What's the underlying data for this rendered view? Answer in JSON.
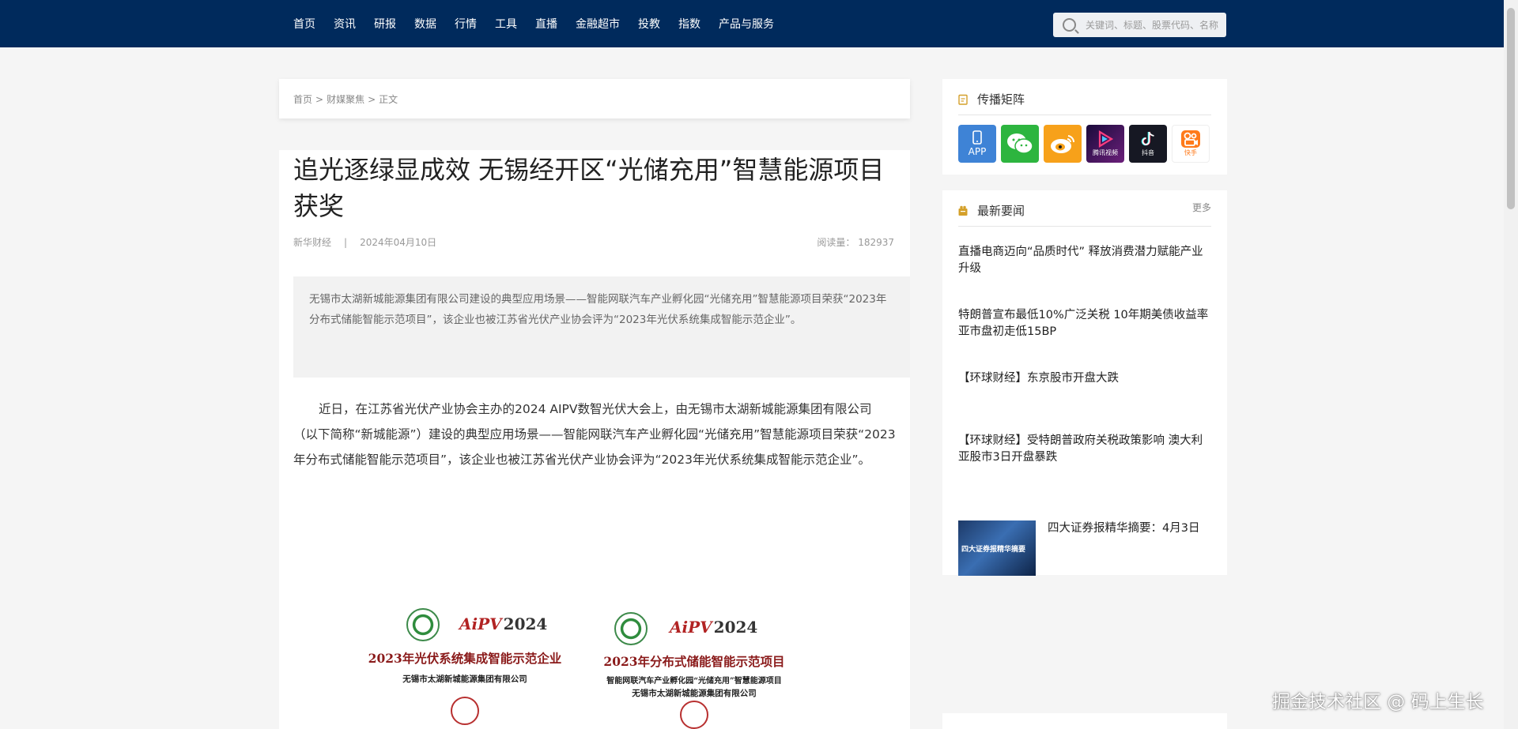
{
  "nav": {
    "items": [
      "首页",
      "资讯",
      "研报",
      "数据",
      "行情",
      "工具",
      "直播",
      "金融超市",
      "投教",
      "指数",
      "产品与服务"
    ],
    "search_placeholder": "关键词、标题、股票代码、名称"
  },
  "breadcrumb": {
    "home": "首页",
    "section": "财媒聚焦",
    "current": "正文",
    "separator": ">"
  },
  "article": {
    "title": "追光逐绿显成效 无锡经开区“光储充用”智慧能源项目获奖",
    "source": "新华财经",
    "date": "2024年04月10日",
    "reads_label": "阅读量：",
    "reads_value": "182937",
    "summary": "无锡市太湖新城能源集团有限公司建设的典型应用场景——智能网联汽车产业孵化园“光储充用”智慧能源项目荣获“2023年分布式储能智能示范项目”，该企业也被江苏省光伏产业协会评为“2023年光伏系统集成智能示范企业”。",
    "body": "近日，在江苏省光伏产业协会主办的2024 AIPV数智光伏大会上，由无锡市太湖新城能源集团有限公司（以下简称“新城能源”）建设的典型应用场景——智能网联汽车产业孵化园“光储充用”智慧能源项目荣获“2023年分布式储能智能示范项目”，该企业也被江苏省光伏产业协会评为“2023年光伏系统集成智能示范企业”。",
    "certificates": [
      {
        "brand": "AiPV",
        "year": "2024",
        "title": "2023年光伏系统集成智能示范企业",
        "lines": [
          "无锡市太湖新城能源集团有限公司"
        ]
      },
      {
        "brand": "AiPV",
        "year": "2024",
        "title": "2023年分布式储能智能示范项目",
        "lines": [
          "智能网联汽车产业孵化园“光储充用”智慧能源项目",
          "无锡市太湖新城能源集团有限公司"
        ]
      }
    ]
  },
  "sidebar": {
    "matrix": {
      "title": "传播矩阵",
      "items": [
        {
          "name": "app-icon",
          "label": "APP",
          "color": "#3e83d6"
        },
        {
          "name": "wechat-icon",
          "label": "",
          "color": "#2db53f"
        },
        {
          "name": "weibo-icon",
          "label": "",
          "color": "#f7a11a"
        },
        {
          "name": "tencent-video-icon",
          "label": "腾讯视频",
          "color": "#3b1466"
        },
        {
          "name": "douyin-icon",
          "label": "抖音",
          "color": "#161823"
        },
        {
          "name": "kuaishou-icon",
          "label": "快手",
          "color": "#ff7a1a"
        }
      ]
    },
    "news": {
      "title": "最新要闻",
      "more": "更多",
      "items": [
        "直播电商迈向“品质时代” 释放消费潜力赋能产业升级",
        "特朗普宣布最低10%广泛关税 10年期美债收益率亚市盘初走低15BP",
        "【环球财经】东京股市开盘大跌",
        "【环球财经】受特朗普政府关税政策影响 澳大利亚股市3日开盘暴跌"
      ],
      "featured": {
        "title": "四大证券报精华摘要：4月3日",
        "thumb_text": "四大证券报精华摘要"
      }
    }
  },
  "watermark": "掘金技术社区 @ 码上生长"
}
